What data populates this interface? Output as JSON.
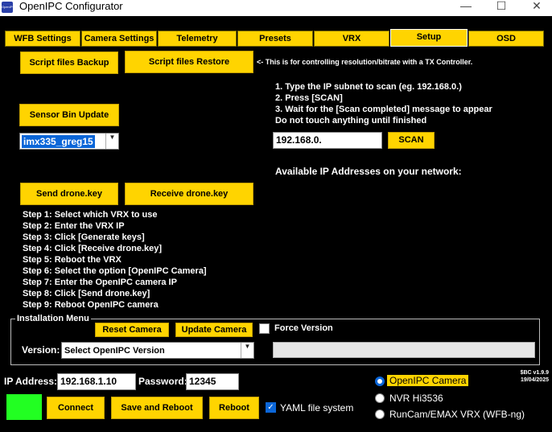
{
  "window": {
    "title": "OpenIPC Configurator",
    "icon_text": "OpenIPC",
    "minimize_glyph": "—",
    "maximize_glyph": "☐",
    "close_glyph": "✕"
  },
  "tabs": [
    {
      "label": "WFB Settings",
      "active": false
    },
    {
      "label": "Camera Settings",
      "active": false
    },
    {
      "label": "Telemetry",
      "active": false
    },
    {
      "label": "Presets",
      "active": false
    },
    {
      "label": "VRX",
      "active": false
    },
    {
      "label": "Setup",
      "active": true
    },
    {
      "label": "OSD",
      "active": false
    }
  ],
  "setup": {
    "script_backup_label": "Script files Backup",
    "script_restore_label": "Script files Restore",
    "tx_controller_note": "<- This is for controlling resolution/bitrate with a TX Controller.",
    "sensor_bin_update_label": "Sensor Bin Update",
    "sensor_select_value": "imx335_greg15",
    "scan_instructions": [
      "1. Type the IP subnet to scan (eg. 192.168.0.)",
      "2. Press [SCAN]",
      "3. Wait for the [Scan completed] message to appear",
      "Do not touch anything until finished"
    ],
    "subnet_value": "192.168.0.",
    "scan_label": "SCAN",
    "available_ips_label": "Available IP Addresses on your network:",
    "send_key_label": "Send drone.key",
    "receive_key_label": "Receive drone.key",
    "steps": [
      "Step 1: Select which VRX to use",
      "Step 2: Enter the VRX IP",
      "Step 3: Click [Generate keys]",
      "Step 4: Click [Receive drone.key]",
      "Step 5: Reboot the VRX",
      "Step 6: Select the option [OpenIPC Camera]",
      "Step 7: Enter the OpenIPC camera IP",
      "Step 8: Click [Send drone.key]",
      "Step 9: Reboot OpenIPC camera"
    ],
    "installation": {
      "group_label": "Installation Menu",
      "reset_camera_label": "Reset Camera",
      "update_camera_label": "Update Camera",
      "force_version_label": "Force Version",
      "force_version_checked": false,
      "version_label": "Version:",
      "version_select_value": "Select OpenIPC Version",
      "version_field_value": ""
    }
  },
  "bottom": {
    "ip_label": "IP Address:",
    "ip_value": "192.168.1.10",
    "password_label": "Password:",
    "password_value": "12345",
    "connect_label": "Connect",
    "save_reboot_label": "Save and Reboot",
    "reboot_label": "Reboot",
    "yaml_label": "YAML file system",
    "yaml_checked": true,
    "status_color": "#22ff22",
    "version_line1": "$BC v1.9.9",
    "version_line2": "19/04/2025",
    "device_options": [
      {
        "label": "OpenIPC Camera",
        "selected": true
      },
      {
        "label": "NVR Hi3536",
        "selected": false
      },
      {
        "label": "RunCam/EMAX VRX (WFB-ng)",
        "selected": false
      }
    ]
  }
}
